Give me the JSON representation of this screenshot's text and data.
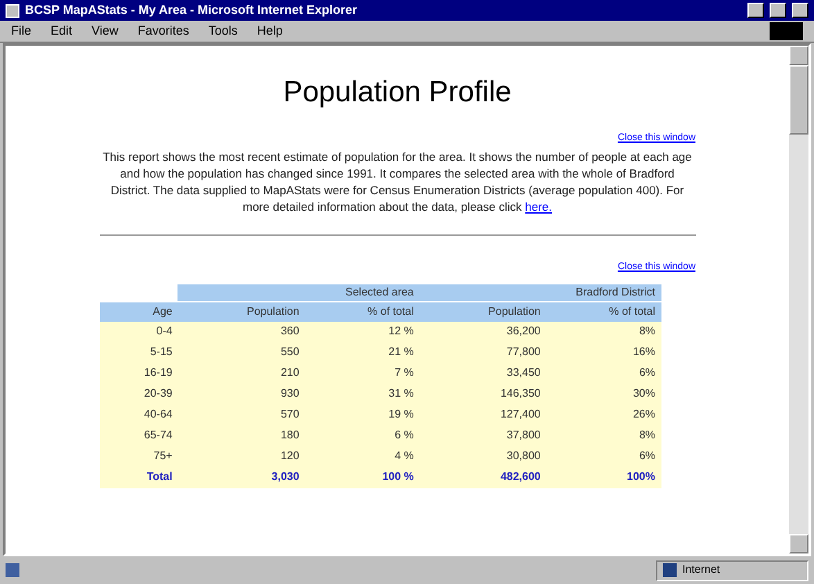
{
  "window": {
    "title": "BCSP MapAStats - My Area - Microsoft Internet Explorer"
  },
  "menu": [
    "File",
    "Edit",
    "View",
    "Favorites",
    "Tools",
    "Help"
  ],
  "page": {
    "heading": "Population Profile",
    "close_link_top": "Close this window",
    "intro": "This report shows the most recent estimate of population for the area. It shows the number of people at each age and how the population has changed since 1991. It compares the selected area with the whole of Bradford District. The data supplied to MapAStats were for Census Enumeration Districts (average population 400). For more detailed information about the data, please click ",
    "intro_link": "here.",
    "close_link_bottom": "Close this window"
  },
  "table": {
    "groups": [
      "Selected area",
      "Bradford District"
    ],
    "columns": [
      "Age",
      "Population",
      "% of total",
      "Population",
      "% of total"
    ],
    "rows": [
      {
        "kind": "data",
        "cells": [
          "0-4",
          "360",
          "12 %",
          "36,200",
          "8%"
        ]
      },
      {
        "kind": "data",
        "cells": [
          "5-15",
          "550",
          "21 %",
          "77,800",
          "16%"
        ]
      },
      {
        "kind": "data",
        "cells": [
          "16-19",
          "210",
          "7 %",
          "33,450",
          "6%"
        ]
      },
      {
        "kind": "data",
        "cells": [
          "20-39",
          "930",
          "31 %",
          "146,350",
          "30%"
        ]
      },
      {
        "kind": "data",
        "cells": [
          "40-64",
          "570",
          "19 %",
          "127,400",
          "26%"
        ]
      },
      {
        "kind": "data",
        "cells": [
          "65-74",
          "180",
          "6 %",
          "37,800",
          "8%"
        ]
      },
      {
        "kind": "data",
        "cells": [
          "75+",
          "120",
          "4 %",
          "30,800",
          "6%"
        ]
      },
      {
        "kind": "total",
        "cells": [
          "Total",
          "3,030",
          "100 %",
          "482,600",
          "100%"
        ]
      }
    ]
  },
  "status_bar": {
    "zone": "Internet"
  }
}
